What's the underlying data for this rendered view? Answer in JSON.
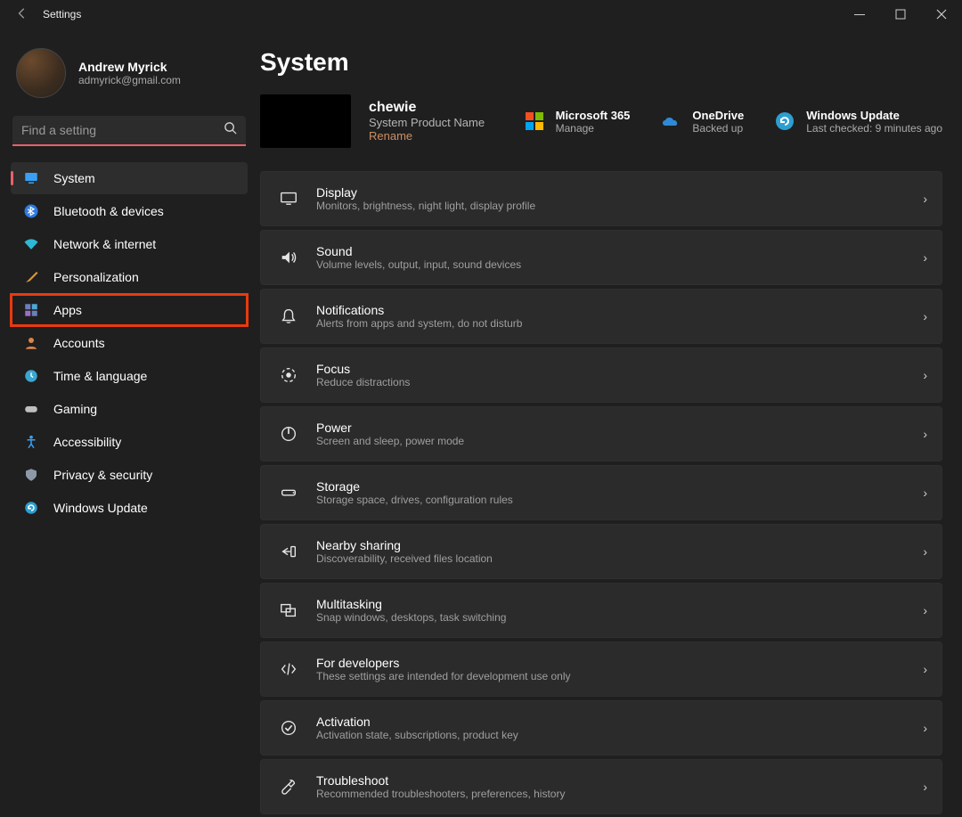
{
  "window": {
    "title": "Settings"
  },
  "user": {
    "name": "Andrew Myrick",
    "email": "admyrick@gmail.com"
  },
  "search": {
    "placeholder": "Find a setting"
  },
  "sidebar": {
    "items": [
      {
        "label": "System"
      },
      {
        "label": "Bluetooth & devices"
      },
      {
        "label": "Network & internet"
      },
      {
        "label": "Personalization"
      },
      {
        "label": "Apps"
      },
      {
        "label": "Accounts"
      },
      {
        "label": "Time & language"
      },
      {
        "label": "Gaming"
      },
      {
        "label": "Accessibility"
      },
      {
        "label": "Privacy & security"
      },
      {
        "label": "Windows Update"
      }
    ]
  },
  "page": {
    "title": "System",
    "device": {
      "name": "chewie",
      "subtitle": "System Product Name",
      "rename": "Rename"
    },
    "status": {
      "m365": {
        "title": "Microsoft 365",
        "sub": "Manage"
      },
      "onedrive": {
        "title": "OneDrive",
        "sub": "Backed up"
      },
      "update": {
        "title": "Windows Update",
        "sub": "Last checked: 9 minutes ago"
      }
    },
    "cards": [
      {
        "title": "Display",
        "sub": "Monitors, brightness, night light, display profile"
      },
      {
        "title": "Sound",
        "sub": "Volume levels, output, input, sound devices"
      },
      {
        "title": "Notifications",
        "sub": "Alerts from apps and system, do not disturb"
      },
      {
        "title": "Focus",
        "sub": "Reduce distractions"
      },
      {
        "title": "Power",
        "sub": "Screen and sleep, power mode"
      },
      {
        "title": "Storage",
        "sub": "Storage space, drives, configuration rules"
      },
      {
        "title": "Nearby sharing",
        "sub": "Discoverability, received files location"
      },
      {
        "title": "Multitasking",
        "sub": "Snap windows, desktops, task switching"
      },
      {
        "title": "For developers",
        "sub": "These settings are intended for development use only"
      },
      {
        "title": "Activation",
        "sub": "Activation state, subscriptions, product key"
      },
      {
        "title": "Troubleshoot",
        "sub": "Recommended troubleshooters, preferences, history"
      }
    ]
  }
}
